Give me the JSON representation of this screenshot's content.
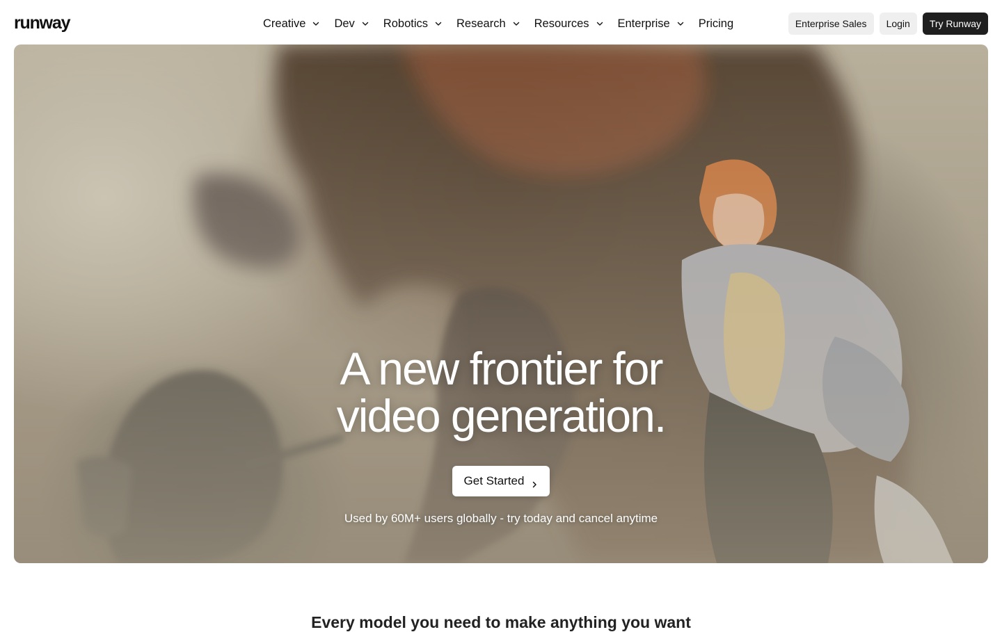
{
  "brand": {
    "logo_text": "runway"
  },
  "nav": {
    "items": [
      {
        "label": "Creative",
        "has_dropdown": true
      },
      {
        "label": "Dev",
        "has_dropdown": true
      },
      {
        "label": "Robotics",
        "has_dropdown": true
      },
      {
        "label": "Research",
        "has_dropdown": true
      },
      {
        "label": "Resources",
        "has_dropdown": true
      },
      {
        "label": "Enterprise",
        "has_dropdown": true
      },
      {
        "label": "Pricing",
        "has_dropdown": false
      }
    ],
    "icons": {
      "dropdown": "chevron-down-icon"
    }
  },
  "header_actions": {
    "enterprise_sales": "Enterprise Sales",
    "login": "Login",
    "try_runway": "Try Runway"
  },
  "hero": {
    "title_line1": "A new frontier for",
    "title_line2": "video generation.",
    "cta_label": "Get Started",
    "cta_icon": "chevron-right-icon",
    "subtitle": "Used by 60M+ users globally - try today and cancel anytime"
  },
  "section": {
    "heading": "Every model you need to make anything you want"
  },
  "colors": {
    "primary_button_bg": "#1f1f1f",
    "secondary_button_bg": "#efefef",
    "text": "#111111",
    "page_bg": "#ffffff"
  }
}
